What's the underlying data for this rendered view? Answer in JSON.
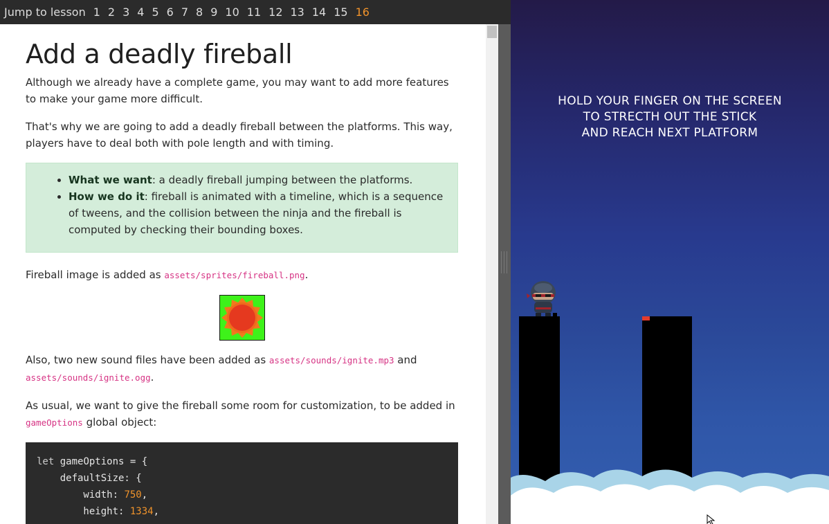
{
  "lessonbar": {
    "label": "Jump to lesson",
    "lessons": [
      "1",
      "2",
      "3",
      "4",
      "5",
      "6",
      "7",
      "8",
      "9",
      "10",
      "11",
      "12",
      "13",
      "14",
      "15",
      "16"
    ],
    "active": "16",
    "active_color": "#f0932b"
  },
  "article": {
    "title": "Add a deadly fireball",
    "p1": "Although we already have a complete game, you may want to add more features to make your game more difficult.",
    "p2": "That's why we are going to add a deadly fireball between the platforms. This way, players have to deal both with pole length and with timing.",
    "note": {
      "item1_bold": "What we want",
      "item1_text": ": a deadly fireball jumping between the platforms.",
      "item2_bold": "How we do it",
      "item2_text": ": fireball is animated with a timeline, which is a sequence of tweens, and the collision between the ninja and the fireball is computed by checking their bounding boxes."
    },
    "p3_text": "Fireball image is added as ",
    "p3_code": "assets/sprites/fireball.png",
    "p3_end": ".",
    "p4_text": "Also, two new sound files have been added as ",
    "p4_code1": "assets/sounds/ignite.mp3",
    "p4_mid": " and",
    "p4_code2": "assets/sounds/ignite.ogg",
    "p4_end": ".",
    "p5_text": "As usual, we want to give the fireball some room for customization, to be added in",
    "p5_code": "gameOptions",
    "p5_end": " global object:",
    "code": {
      "line1_kw": "let",
      "line1_rest": " gameOptions = {",
      "line2": "    defaultSize: {",
      "line3_key": "        width: ",
      "line3_val": "750",
      "line3_end": ",",
      "line4_key": "        height: ",
      "line4_val": "1334",
      "line4_end": ","
    }
  },
  "game": {
    "instruction_line1": "HOLD YOUR FINGER ON THE SCREEN",
    "instruction_line2": "TO STRECTH OUT THE STICK",
    "instruction_line3": "AND REACH NEXT PLATFORM"
  },
  "colors": {
    "note_bg": "#d4edda",
    "code_bg": "#2b2b2b",
    "inline_code": "#d63384",
    "pillar": "#000000",
    "fireball_bg": "#3ef21a"
  }
}
